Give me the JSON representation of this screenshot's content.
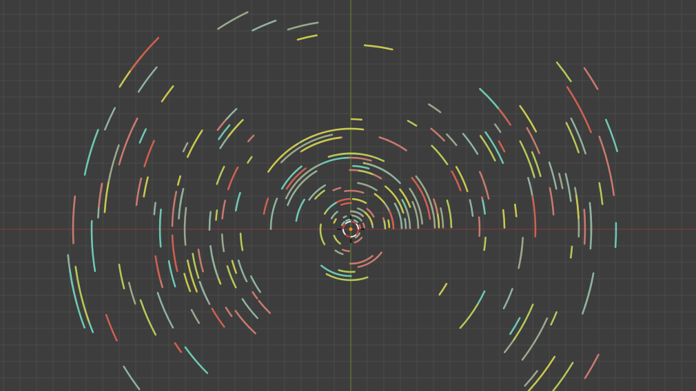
{
  "viewport": {
    "background": "#3d3d3d",
    "grid_color": "#4a4a4a",
    "x_axis_color": "#8c3a3a",
    "y_axis_color": "#6c8a2e"
  },
  "palette": [
    "#c9c94e",
    "#6ec8b4",
    "#c97a6e",
    "#d06050",
    "#9aa88c",
    "#b6c858",
    "#8fb3a0"
  ],
  "cursor": {
    "name": "3d-cursor-icon",
    "ring_color_a": "#e04040",
    "ring_color_b": "#f0f0f0",
    "center_color": "#ff9020"
  }
}
